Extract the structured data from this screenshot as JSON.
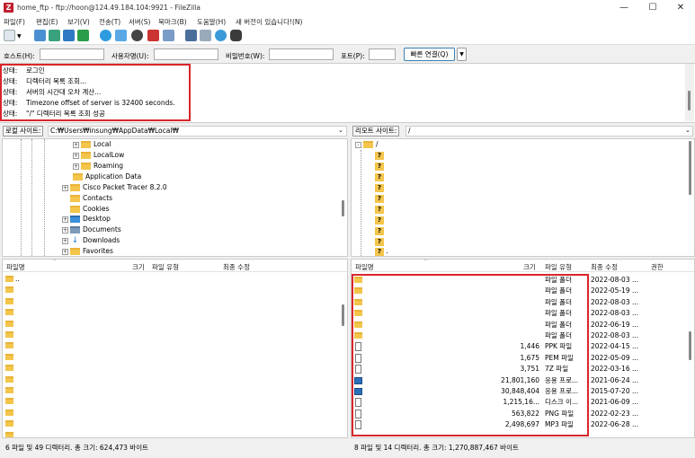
{
  "window": {
    "title": "home_ftp - ftp://hoon@124.49.184.104:9921 - FileZilla",
    "app_icon": "filezilla-icon"
  },
  "menu": [
    "파일(F)",
    "편집(E)",
    "보기(V)",
    "전송(T)",
    "서버(S)",
    "북마크(B)",
    "도움말(H)",
    "새 버전이 있습니다!(N)"
  ],
  "quickconnect": {
    "host_label": "호스트(H):",
    "user_label": "사용자명(U):",
    "pass_label": "비밀번호(W):",
    "port_label": "포트(P):",
    "host_value": "",
    "user_value": "",
    "pass_value": "",
    "port_value": "",
    "connect_label": "빠른 연결(Q)"
  },
  "log": [
    {
      "k": "상태:",
      "v": "로그인"
    },
    {
      "k": "상태:",
      "v": "디렉터리 목록 조회..."
    },
    {
      "k": "상태:",
      "v": "서버의 시간대 오차 계산..."
    },
    {
      "k": "상태:",
      "v": "Timezone offset of server is 32400 seconds."
    },
    {
      "k": "상태:",
      "v": "\"/\" 디렉터리 목록 조회 성공"
    }
  ],
  "local": {
    "site_label": "로컬 사이트:",
    "site_path": "C:₩Users₩insung₩AppData₩Local₩",
    "tree": [
      "Local",
      "LocalLow",
      "Roaming",
      "Application Data",
      "Cisco Packet Tracer 8.2.0",
      "Contacts",
      "Cookies",
      "Desktop",
      "Documents",
      "Downloads",
      "Favorites"
    ],
    "headers": {
      "name": "파일명",
      "size": "크기",
      "type": "파일 유형",
      "modified": "최종 수정"
    },
    "first_row": "..",
    "status": "6 파일 및 49 디렉터리. 총 크기: 624,473 바이트"
  },
  "remote": {
    "site_label": "리모트 사이트:",
    "site_path": "/",
    "root": "/",
    "tree_last": ".",
    "headers": {
      "name": "파일명",
      "size": "크기",
      "type": "파일 유형",
      "modified": "최종 수정",
      "perm": "권한"
    },
    "rows": [
      {
        "size": "",
        "type": "파일 폴더",
        "modified": "2022-08-03 ...",
        "icon": "folder"
      },
      {
        "size": "",
        "type": "파일 폴더",
        "modified": "2022-05-19 ...",
        "icon": "folder"
      },
      {
        "size": "",
        "type": "파일 폴더",
        "modified": "2022-08-03 ...",
        "icon": "folder"
      },
      {
        "size": "",
        "type": "파일 폴더",
        "modified": "2022-08-03 ...",
        "icon": "folder"
      },
      {
        "size": "",
        "type": "파일 폴더",
        "modified": "2022-06-19 ...",
        "icon": "folder"
      },
      {
        "size": "",
        "type": "파일 폴더",
        "modified": "2022-08-03 ...",
        "icon": "folder"
      },
      {
        "size": "1,446",
        "type": "PPK 파일",
        "modified": "2022-04-15 ...",
        "icon": "doc"
      },
      {
        "size": "1,675",
        "type": "PEM 파일",
        "modified": "2022-05-09 ...",
        "icon": "doc"
      },
      {
        "size": "3,751",
        "type": "7Z 파일",
        "modified": "2022-03-16 ...",
        "icon": "doc"
      },
      {
        "size": "21,801,160",
        "type": "응용 프로...",
        "modified": "2021-06-24 ...",
        "icon": "exe"
      },
      {
        "size": "30,848,404",
        "type": "응용 프로...",
        "modified": "2015-07-20 ...",
        "icon": "exe"
      },
      {
        "size": "1,215,16...",
        "type": "디스크 이...",
        "modified": "2021-06-09 ...",
        "icon": "doc"
      },
      {
        "size": "563,822",
        "type": "PNG 파일",
        "modified": "2022-02-23 ...",
        "icon": "doc"
      },
      {
        "size": "2,498,697",
        "type": "MP3 파일",
        "modified": "2022-06-28 ...",
        "icon": "doc"
      }
    ],
    "status": "8 파일 및 14 디렉터리. 총 크기: 1,270,887,467 바이트"
  }
}
